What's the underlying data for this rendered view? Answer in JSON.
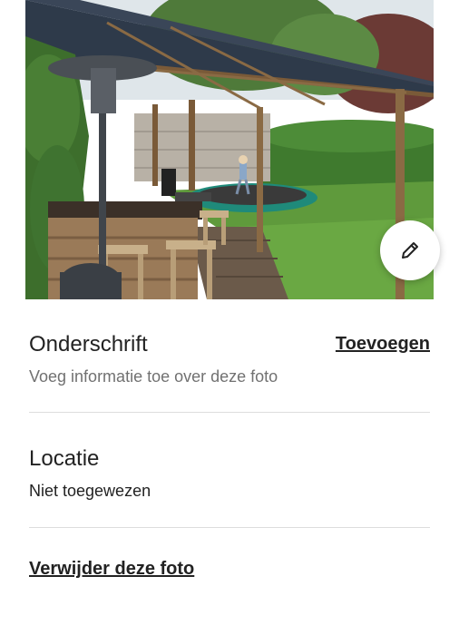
{
  "photo": {
    "image_icon": "garden-pergola-photo",
    "edit_icon": "pencil-icon"
  },
  "caption": {
    "title": "Onderschrift",
    "add_label": "Toevoegen",
    "subtitle": "Voeg informatie toe over deze foto"
  },
  "location": {
    "title": "Locatie",
    "value": "Niet toegewezen"
  },
  "delete_label": "Verwijder deze foto",
  "colors": {
    "text_primary": "#222222",
    "text_secondary": "#717171",
    "divider": "#dddddd"
  }
}
